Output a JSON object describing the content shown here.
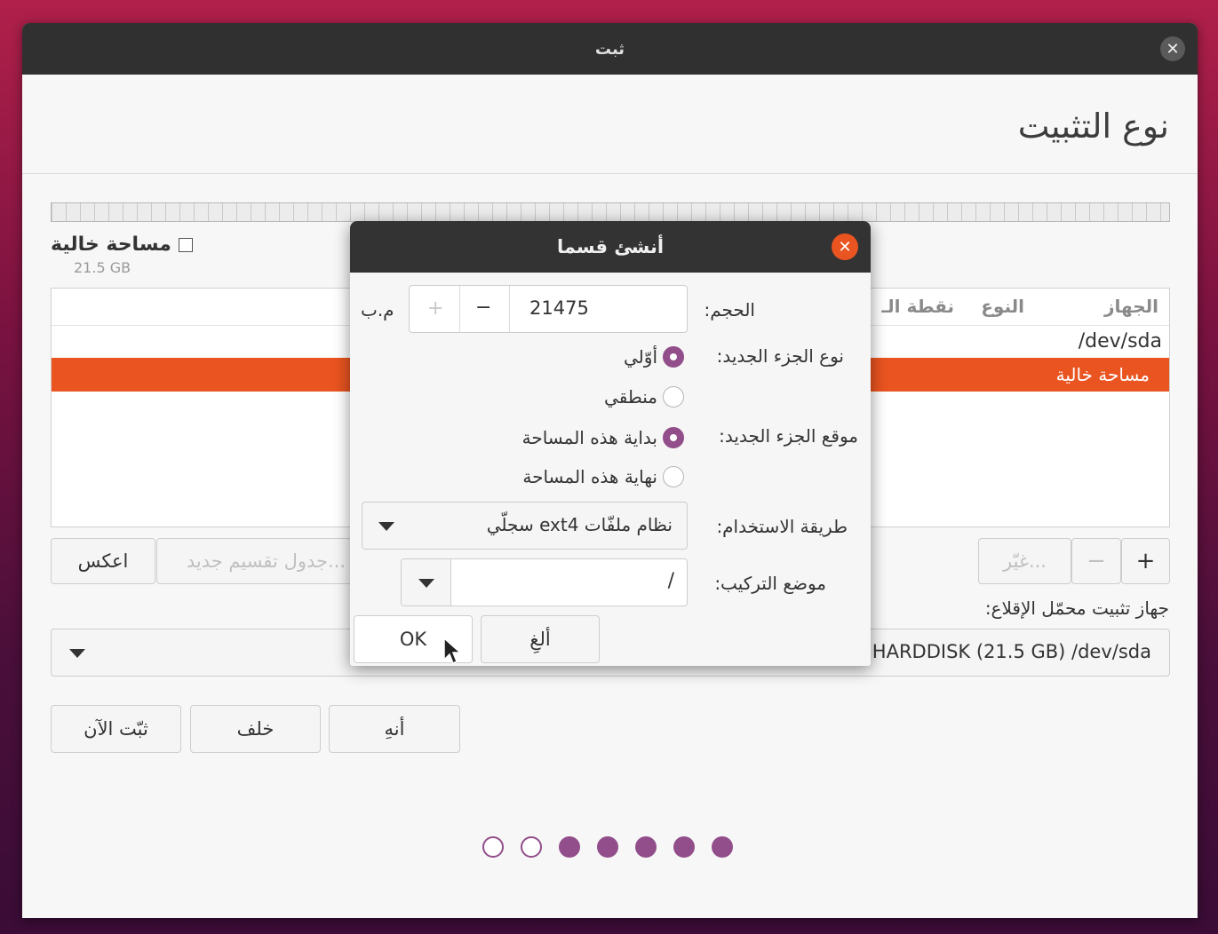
{
  "window": {
    "title": "ثبت",
    "close_glyph": "✕"
  },
  "page": {
    "title": "نوع التثبيت"
  },
  "free_space": {
    "label": "مساحة خالية",
    "size": "21.5 GB"
  },
  "table": {
    "headers": [
      "الجهاز",
      "النوع",
      "نقطة الـ"
    ],
    "rows": [
      "/dev/sda"
    ],
    "selected_row": "مساحة خالية"
  },
  "buttons": {
    "plus": "+",
    "minus": "−",
    "change": "غيّر...",
    "new_table": "جدول تقسيم جديد...",
    "revert": "اعكس",
    "quit": "أنهِ",
    "back": "خلف",
    "install_now": "ثبّت الآن"
  },
  "bootloader": {
    "label": "جهاز تثبيت محمّل الإقلاع:",
    "device": "HARDDISK (21.5 GB)   /dev/sda"
  },
  "progress": {
    "total_steps": 7,
    "completed_steps": 5
  },
  "dialog": {
    "title": "أنشئ قسما",
    "close_glyph": "✕",
    "size_label": "الحجم:",
    "size_value": "21475",
    "size_unit": "م.ب",
    "type_label": "نوع الجزء الجديد:",
    "type_options": [
      "أوّلي",
      "منطقي"
    ],
    "type_selected": "أوّلي",
    "location_label": "موقع الجزء الجديد:",
    "location_options": [
      "بداية هذه المساحة",
      "نهاية هذه المساحة"
    ],
    "location_selected": "بداية هذه المساحة",
    "use_as_label": "طريقة الاستخدام:",
    "use_as_value": "نظام ملفّات ext4 سجلّي",
    "mount_label": "موضع التركيب:",
    "mount_value": "/",
    "cancel": "ألغِ",
    "ok": "OK"
  },
  "colors": {
    "accent": "#e95420",
    "aubergine": "#924d8b"
  }
}
